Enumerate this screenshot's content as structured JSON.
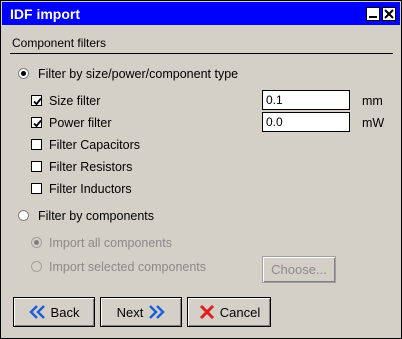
{
  "window": {
    "title": "IDF import"
  },
  "section": {
    "label": "Component filters"
  },
  "options": {
    "filter_by_type_label": "Filter by size/power/component type",
    "filter_by_type_selected": true,
    "filter_by_components_label": "Filter by components",
    "filter_by_components_selected": false
  },
  "filters": {
    "size": {
      "label": "Size filter",
      "checked": true,
      "value": "0.1",
      "unit": "mm"
    },
    "power": {
      "label": "Power filter",
      "checked": true,
      "value": "0.0",
      "unit": "mW"
    },
    "capacitors": {
      "label": "Filter Capacitors",
      "checked": false
    },
    "resistors": {
      "label": "Filter Resistors",
      "checked": false
    },
    "inductors": {
      "label": "Filter Inductors",
      "checked": false
    }
  },
  "components": {
    "import_all_label": "Import all components",
    "import_all_selected": true,
    "import_selected_label": "Import selected components",
    "import_selected_selected": false,
    "choose_label": "Choose..."
  },
  "buttons": {
    "back": "Back",
    "next": "Next",
    "cancel": "Cancel"
  },
  "colors": {
    "titlebar": "#0000ff",
    "background": "#d4d0c8",
    "arrow": "#1e5fd6",
    "cancel_x": "#e02020"
  }
}
